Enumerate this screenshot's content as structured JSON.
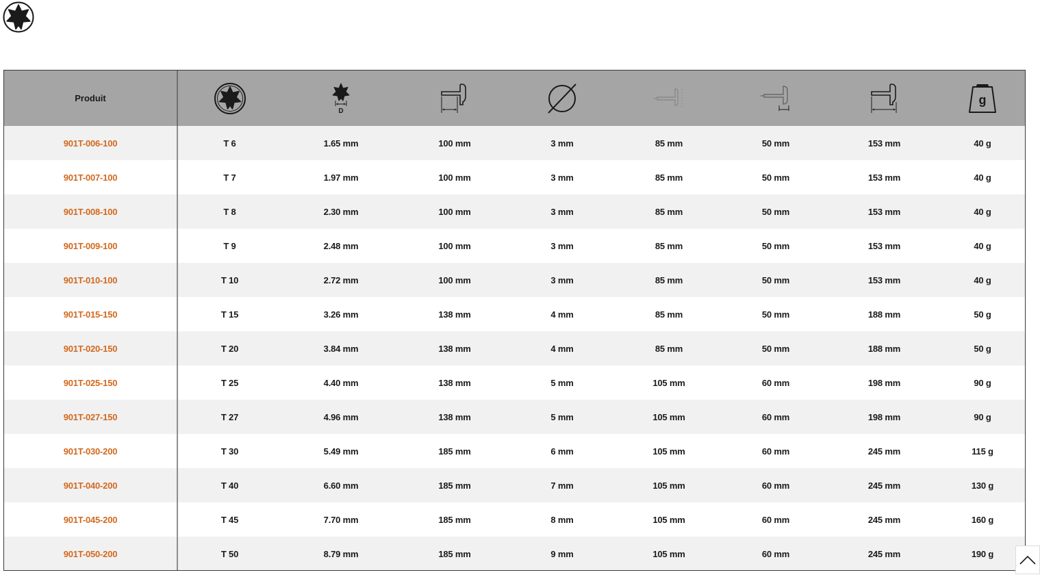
{
  "header": {
    "product_label": "Produit",
    "weight_symbol": "g",
    "diameter_letter": "D"
  },
  "icons": {
    "top_logo": "torx-icon",
    "columns": [
      "torx-size-icon",
      "star-diameter-icon",
      "short-arm-length-icon",
      "shaft-diameter-icon",
      "blade-length-icon",
      "handle-width-icon",
      "total-length-icon",
      "weight-icon"
    ],
    "scroll_top": "chevron-up-icon"
  },
  "colors": {
    "header_bg": "#a5a5a5",
    "product_text": "#d2691e",
    "row_alt": "#f1f1f1"
  },
  "rows": [
    {
      "product": "901T-006-100",
      "size": "T 6",
      "d": "1.65 mm",
      "l1": "100 mm",
      "diam": "3 mm",
      "l2": "85 mm",
      "l3": "50 mm",
      "l4": "153 mm",
      "weight": "40 g"
    },
    {
      "product": "901T-007-100",
      "size": "T 7",
      "d": "1.97 mm",
      "l1": "100 mm",
      "diam": "3 mm",
      "l2": "85 mm",
      "l3": "50 mm",
      "l4": "153 mm",
      "weight": "40 g"
    },
    {
      "product": "901T-008-100",
      "size": "T 8",
      "d": "2.30 mm",
      "l1": "100 mm",
      "diam": "3 mm",
      "l2": "85 mm",
      "l3": "50 mm",
      "l4": "153 mm",
      "weight": "40 g"
    },
    {
      "product": "901T-009-100",
      "size": "T 9",
      "d": "2.48 mm",
      "l1": "100 mm",
      "diam": "3 mm",
      "l2": "85 mm",
      "l3": "50 mm",
      "l4": "153 mm",
      "weight": "40 g"
    },
    {
      "product": "901T-010-100",
      "size": "T 10",
      "d": "2.72 mm",
      "l1": "100 mm",
      "diam": "3 mm",
      "l2": "85 mm",
      "l3": "50 mm",
      "l4": "153 mm",
      "weight": "40 g"
    },
    {
      "product": "901T-015-150",
      "size": "T 15",
      "d": "3.26 mm",
      "l1": "138 mm",
      "diam": "4 mm",
      "l2": "85 mm",
      "l3": "50 mm",
      "l4": "188 mm",
      "weight": "50 g"
    },
    {
      "product": "901T-020-150",
      "size": "T 20",
      "d": "3.84 mm",
      "l1": "138 mm",
      "diam": "4 mm",
      "l2": "85 mm",
      "l3": "50 mm",
      "l4": "188 mm",
      "weight": "50 g"
    },
    {
      "product": "901T-025-150",
      "size": "T 25",
      "d": "4.40 mm",
      "l1": "138 mm",
      "diam": "5 mm",
      "l2": "105 mm",
      "l3": "60 mm",
      "l4": "198 mm",
      "weight": "90 g"
    },
    {
      "product": "901T-027-150",
      "size": "T 27",
      "d": "4.96 mm",
      "l1": "138 mm",
      "diam": "5 mm",
      "l2": "105 mm",
      "l3": "60 mm",
      "l4": "198 mm",
      "weight": "90 g"
    },
    {
      "product": "901T-030-200",
      "size": "T 30",
      "d": "5.49 mm",
      "l1": "185 mm",
      "diam": "6 mm",
      "l2": "105 mm",
      "l3": "60 mm",
      "l4": "245 mm",
      "weight": "115 g"
    },
    {
      "product": "901T-040-200",
      "size": "T 40",
      "d": "6.60 mm",
      "l1": "185 mm",
      "diam": "7 mm",
      "l2": "105 mm",
      "l3": "60 mm",
      "l4": "245 mm",
      "weight": "130 g"
    },
    {
      "product": "901T-045-200",
      "size": "T 45",
      "d": "7.70 mm",
      "l1": "185 mm",
      "diam": "8 mm",
      "l2": "105 mm",
      "l3": "60 mm",
      "l4": "245 mm",
      "weight": "160 g"
    },
    {
      "product": "901T-050-200",
      "size": "T 50",
      "d": "8.79 mm",
      "l1": "185 mm",
      "diam": "9 mm",
      "l2": "105 mm",
      "l3": "60 mm",
      "l4": "245 mm",
      "weight": "190 g"
    }
  ]
}
